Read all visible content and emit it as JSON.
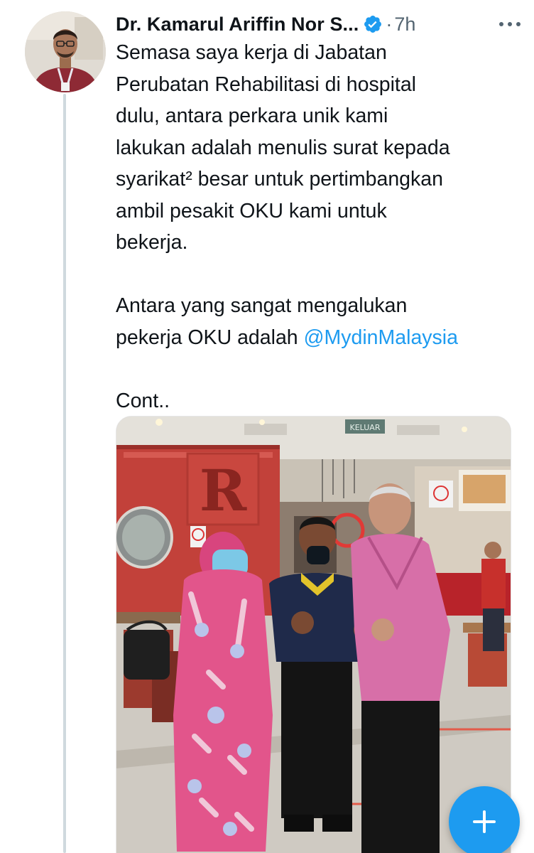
{
  "tweet": {
    "author_name": "Dr. Kamarul Ariffin Nor S...",
    "separator": "·",
    "timestamp": "7h",
    "lines": [
      "Semasa saya kerja di Jabatan",
      "Perubatan Rehabilitasi di hospital",
      "dulu, antara perkara unik kami",
      "lakukan adalah menulis surat kepada",
      "syarikat² besar untuk pertimbangkan",
      "ambil pesakit OKU kami untuk",
      "bekerja."
    ],
    "line2_a": "Antara yang sangat mengalukan",
    "line2_b_prefix": "pekerja OKU adalah ",
    "mention": "@MydinMalaysia",
    "cont": "Cont..",
    "photo": {
      "sign_letter": "R",
      "exit_sign": "KELUAR"
    }
  },
  "icons": {
    "verified": "verified-badge-icon",
    "more": "more-horizontal-icon",
    "compose": "plus-icon"
  },
  "colors": {
    "accent": "#1d9bf0",
    "text": "#0f1419",
    "muted": "#536471",
    "thread_line": "#cfd9de"
  }
}
